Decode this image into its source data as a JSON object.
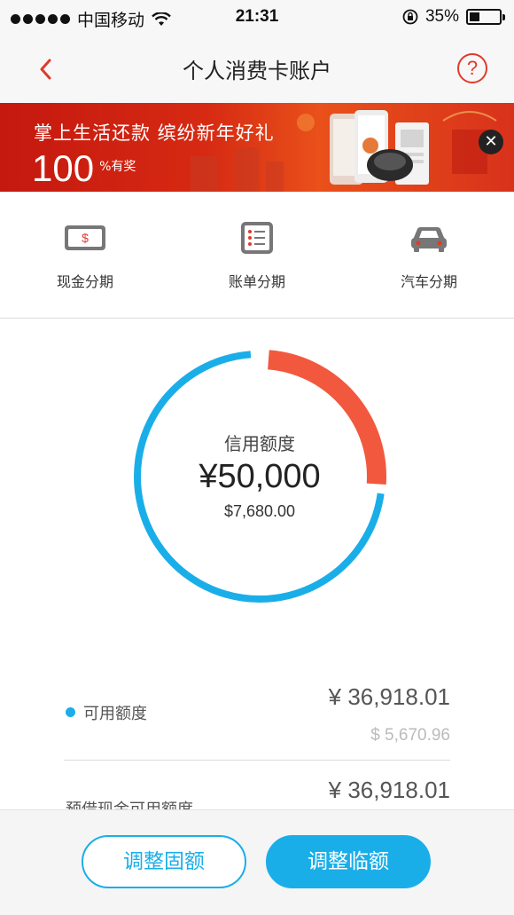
{
  "status_bar": {
    "carrier": "中国移动",
    "time": "21:31",
    "battery": "35%",
    "battery_level": 0.35
  },
  "nav": {
    "title": "个人消费卡账户",
    "back_icon": "chevron-left-icon",
    "help_label": "?"
  },
  "banner": {
    "line1": "掌上生活还款   缤纷新年好礼",
    "number": "100",
    "suffix": "%有奖",
    "close_label": "✕"
  },
  "shortcuts": [
    {
      "label": "现金分期",
      "icon": "cash-installment-icon"
    },
    {
      "label": "账单分期",
      "icon": "bill-installment-icon"
    },
    {
      "label": "汽车分期",
      "icon": "car-installment-icon"
    }
  ],
  "credit": {
    "label": "信用额度",
    "amount": "¥50,000",
    "amount_usd": "$7,680.00",
    "used_fraction": 0.26,
    "colors": {
      "available": "#1aaee9",
      "used": "#f2583e"
    }
  },
  "rows": [
    {
      "label": "可用额度",
      "value": "¥ 36,918.01",
      "sub": "$ 5,670.96"
    },
    {
      "label": "预借现金可用额度",
      "value": "¥ 36,918.01"
    }
  ],
  "buttons": {
    "adjust_fixed": "调整固额",
    "adjust_temp": "调整临额"
  }
}
